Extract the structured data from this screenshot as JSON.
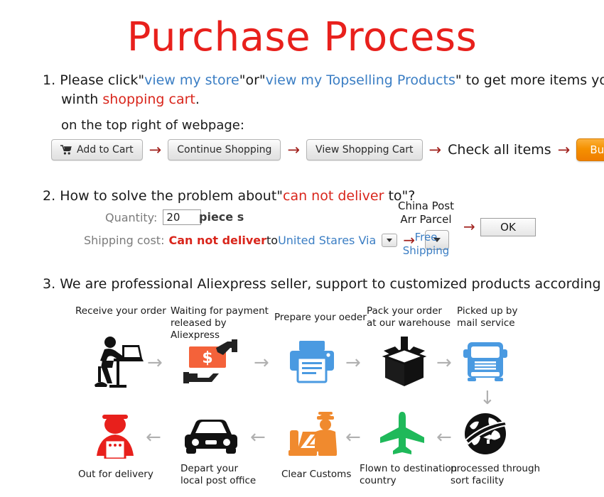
{
  "title": "Purchase Process",
  "colors": {
    "title_red": "#e8201c",
    "link_blue": "#3b7ec4",
    "alert_red": "#d9261c",
    "arrow_red": "#a1211d",
    "flow_arrow_grey": "#b0b0b0",
    "buy_now_orange": "#f59100",
    "icon_blue": "#4a9ae1",
    "icon_orange": "#f4623a",
    "icon_customs_orange": "#f08a2e",
    "icon_green": "#1fb95a",
    "icon_red": "#e8201c",
    "icon_black": "#111111"
  },
  "section1": {
    "number": "1.",
    "line1_prefix": "Please click\"",
    "link_store": "view my store",
    "line1_mid": "\"or\"",
    "link_topselling": "view my Topselling Products",
    "line1_suffix": "\" to get more items you want",
    "line2_prefix": "winth ",
    "line2_red": "shopping cart",
    "line2_suffix": ".",
    "subhead": "on the top right of webpage:",
    "buttons": [
      {
        "label": "Add to Cart",
        "icon": "shopping-cart-icon",
        "style": "grey"
      },
      {
        "label": "Continue Shopping",
        "icon": "",
        "style": "grey"
      },
      {
        "label": "View Shopping Cart",
        "icon": "",
        "style": "grey"
      },
      {
        "label": "Buy Now",
        "icon": "",
        "style": "orange"
      }
    ],
    "check_all_items": "Check all items",
    "arrow_glyph": "→"
  },
  "section2": {
    "number": "2.",
    "head_prefix": "How to solve the problem about\"",
    "head_red": "can not deliver",
    "head_suffix": " to\"?",
    "quantity_label": "Quantity:",
    "quantity_value": "20",
    "quantity_unit": "piece s",
    "shipping_label": "Shipping cost:",
    "shipping_red": "Can not deliver",
    "shipping_to": " to ",
    "shipping_country": "United Stares Via",
    "dropdown_small_icon": "chevron-down-icon",
    "dropdown_big_icon": "chevron-down-icon",
    "carrier_line1": "China Post",
    "carrier_line2": "Arr Parcel",
    "free_line1": "Free",
    "free_line2": "Shipping",
    "ok_label": "OK",
    "arrow_glyph": "→"
  },
  "section3": {
    "number": "3.",
    "head": "We are professional Aliexpress seller, support to customized products according to your requirment.",
    "row1": [
      {
        "label_line1": "Receive your order",
        "label_line2": "",
        "icon": "person-at-desk-icon"
      },
      {
        "label_line1": "Waiting for payment",
        "label_line2": "released by Aliexpress",
        "icon": "money-handoff-icon"
      },
      {
        "label_line1": "Prepare your oeder",
        "label_line2": "",
        "icon": "printer-icon"
      },
      {
        "label_line1": "Pack your order",
        "label_line2": "at our warehouse",
        "icon": "package-box-icon"
      },
      {
        "label_line1": "Picked up by",
        "label_line2": "mail service",
        "icon": "truck-icon"
      }
    ],
    "row2": [
      {
        "label_line1": "Out for delivery",
        "label_line2": "",
        "icon": "delivery-person-icon"
      },
      {
        "label_line1": "Depart your",
        "label_line2": "local post office",
        "icon": "car-icon"
      },
      {
        "label_line1": "Clear Customs",
        "label_line2": "",
        "icon": "customs-officer-icon"
      },
      {
        "label_line1": "Flown to destination",
        "label_line2": "country",
        "icon": "airplane-icon"
      },
      {
        "label_line1": "processed through",
        "label_line2": "sort facility",
        "icon": "globe-sort-icon"
      }
    ],
    "arrow_right": "→",
    "arrow_left": "←",
    "arrow_down": "↓"
  }
}
